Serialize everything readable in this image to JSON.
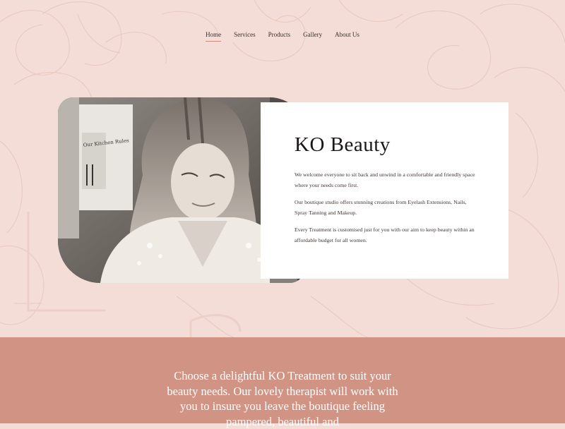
{
  "nav": {
    "items": [
      {
        "label": "Home",
        "active": true
      },
      {
        "label": "Services",
        "active": false
      },
      {
        "label": "Products",
        "active": false
      },
      {
        "label": "Gallery",
        "active": false
      },
      {
        "label": "About Us",
        "active": false
      }
    ]
  },
  "hero": {
    "photo_sign_text": "Our Kitchen Rules",
    "title": "KO Beauty",
    "paragraphs": [
      "We welcome everyone to sit back and unwind in a comfortable and friendly space where your needs come first.",
      "Our boutique studio offers stunning creations from Eyelash Extensions, Nails, Spray Tanning and Makeup.",
      "Every Treatment is customised just for you with our aim to keep beauty within an affordable budget for all women."
    ]
  },
  "band": {
    "text": "Choose a delightful KO Treatment to suit your beauty needs. Our lovely therapist will work with you to insure you leave the boutique feeling pampered, beautiful and"
  },
  "colors": {
    "background": "#f4ddd6",
    "band": "#d19484",
    "card": "#ffffff",
    "nav_underline": "#c98a7c"
  }
}
